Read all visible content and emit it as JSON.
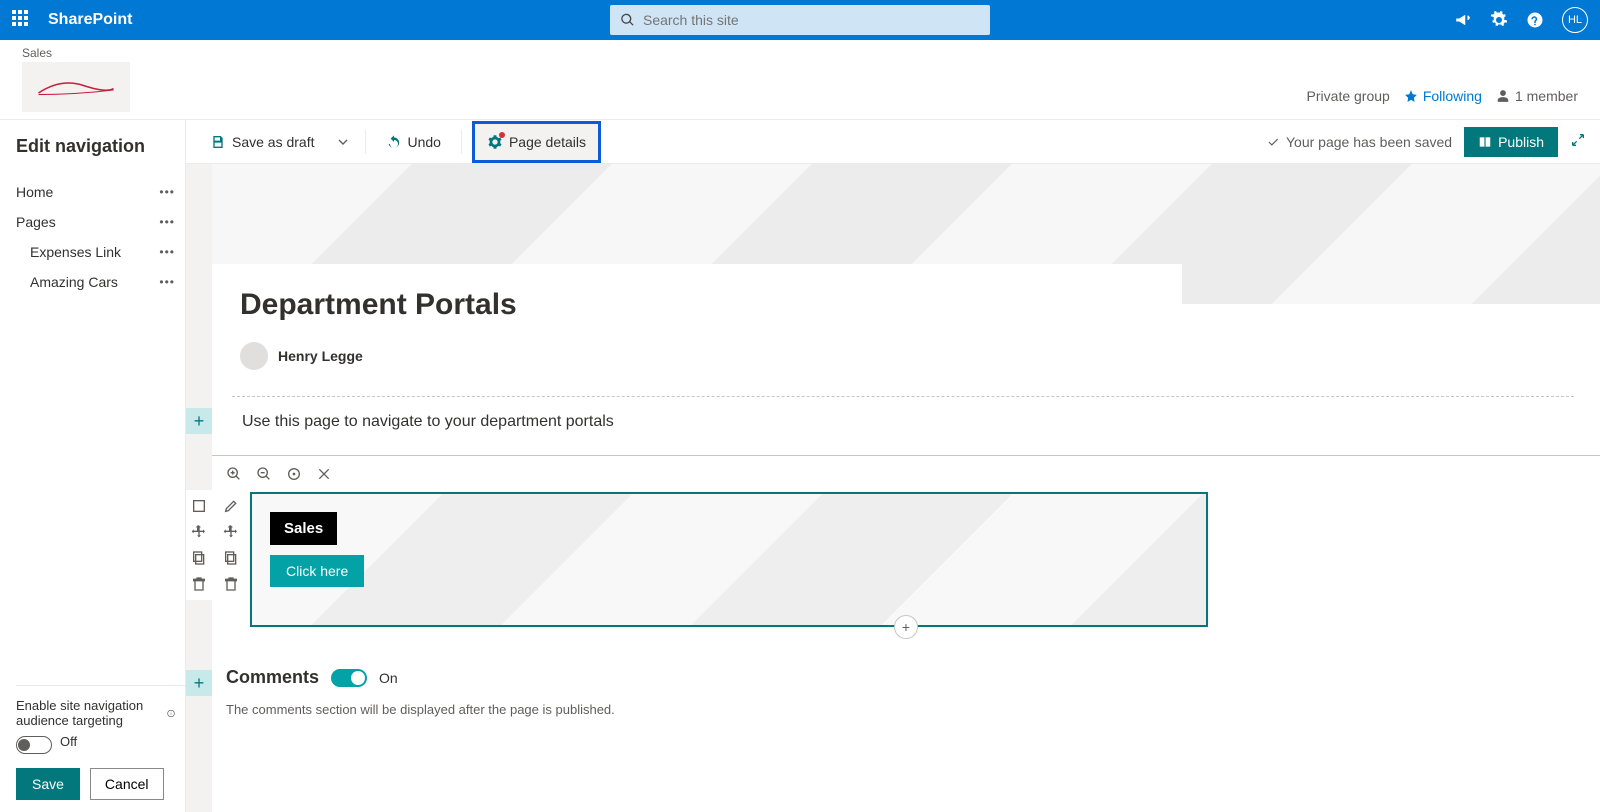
{
  "suite": {
    "app_name": "SharePoint",
    "search_placeholder": "Search this site",
    "avatar_initials": "HL"
  },
  "site": {
    "name": "Sales",
    "privacy": "Private group",
    "following_label": "Following",
    "members_label": "1 member"
  },
  "nav": {
    "title": "Edit navigation",
    "items": [
      {
        "label": "Home"
      },
      {
        "label": "Pages"
      }
    ],
    "sub_items": [
      {
        "label": "Expenses Link"
      },
      {
        "label": "Amazing Cars"
      }
    ],
    "audience_targeting_label": "Enable site navigation audience targeting",
    "toggle_state": "Off",
    "save_label": "Save",
    "cancel_label": "Cancel"
  },
  "commandbar": {
    "save_draft": "Save as draft",
    "undo": "Undo",
    "page_details": "Page details",
    "saved_msg": "Your page has been saved",
    "publish": "Publish"
  },
  "page": {
    "title": "Department Portals",
    "author": "Henry Legge",
    "description": "Use this page to navigate to your department portals",
    "hero_tile_label": "Sales",
    "hero_tile_button": "Click here"
  },
  "comments": {
    "heading": "Comments",
    "state_label": "On",
    "note": "The comments section will be displayed after the page is published."
  }
}
